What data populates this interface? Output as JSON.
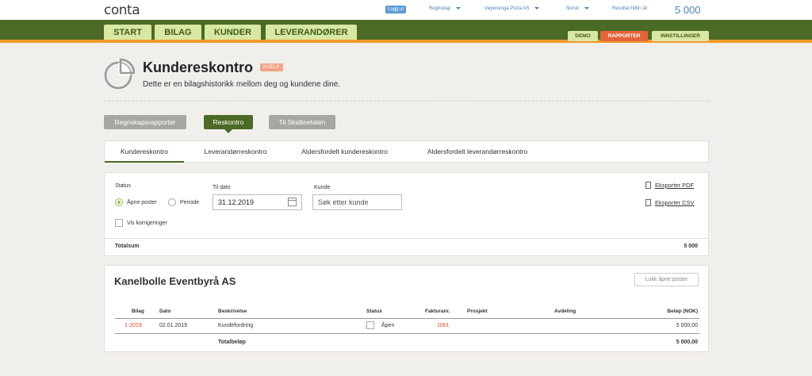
{
  "header": {
    "logo": "conta",
    "logout": "Logg ut",
    "menus": [
      "Regnskap",
      "Vøyenenga Pizza AS",
      "Norsk"
    ],
    "result_label": "Resultat hittil i år",
    "result_value": "5 000"
  },
  "nav": {
    "tabs": [
      "START",
      "BILAG",
      "KUNDER",
      "LEVERANDØRER"
    ],
    "right_buttons": [
      "DEMO",
      "RAPPORTER",
      "INNSTILLINGER"
    ]
  },
  "page": {
    "title": "Kundereskontro",
    "help": "HJELP",
    "subtitle": "Dette er en bilagshistorikk mellom deg og kundene dine."
  },
  "report_buttons": [
    "Regnskapsrapporter",
    "Reskontro",
    "Til Skatteetaten"
  ],
  "subtabs": [
    "Kundereskontro",
    "Leverandørreskontro",
    "Aldersfordelt kundereskontro",
    "Aldersfordelt leverandørreskontro"
  ],
  "filter": {
    "status_label": "Status",
    "radio_open": "Åpne poster",
    "radio_period": "Periode",
    "show_corrections": "Vis korrigeringer",
    "to_date_label": "Til dato",
    "to_date_value": "31.12.2019",
    "customer_label": "Kunde",
    "customer_placeholder": "Søk etter kunde",
    "export_pdf": "Eksporter PDF",
    "export_csv": "Eksporter CSV",
    "total_label": "Totalsum",
    "total_value": "5 000"
  },
  "customer": {
    "name": "Kanelbolle Eventbyrå AS",
    "close_button": "Lukk åpne poster",
    "columns": [
      "Bilag",
      "Dato",
      "Beskrivelse",
      "Status",
      "Fakturanr.",
      "Prosjekt",
      "Avdeling",
      "Beløp (NOK)"
    ],
    "rows": [
      {
        "bilag": "1-2019",
        "dato": "02.01.2019",
        "beskrivelse": "Kundefordring",
        "status": "Åpen",
        "fakturanr": "1001",
        "prosjekt": "",
        "avdeling": "",
        "belop": "5 000,00"
      }
    ],
    "total_label": "Totalbeløp",
    "total_value": "5 000,00"
  }
}
